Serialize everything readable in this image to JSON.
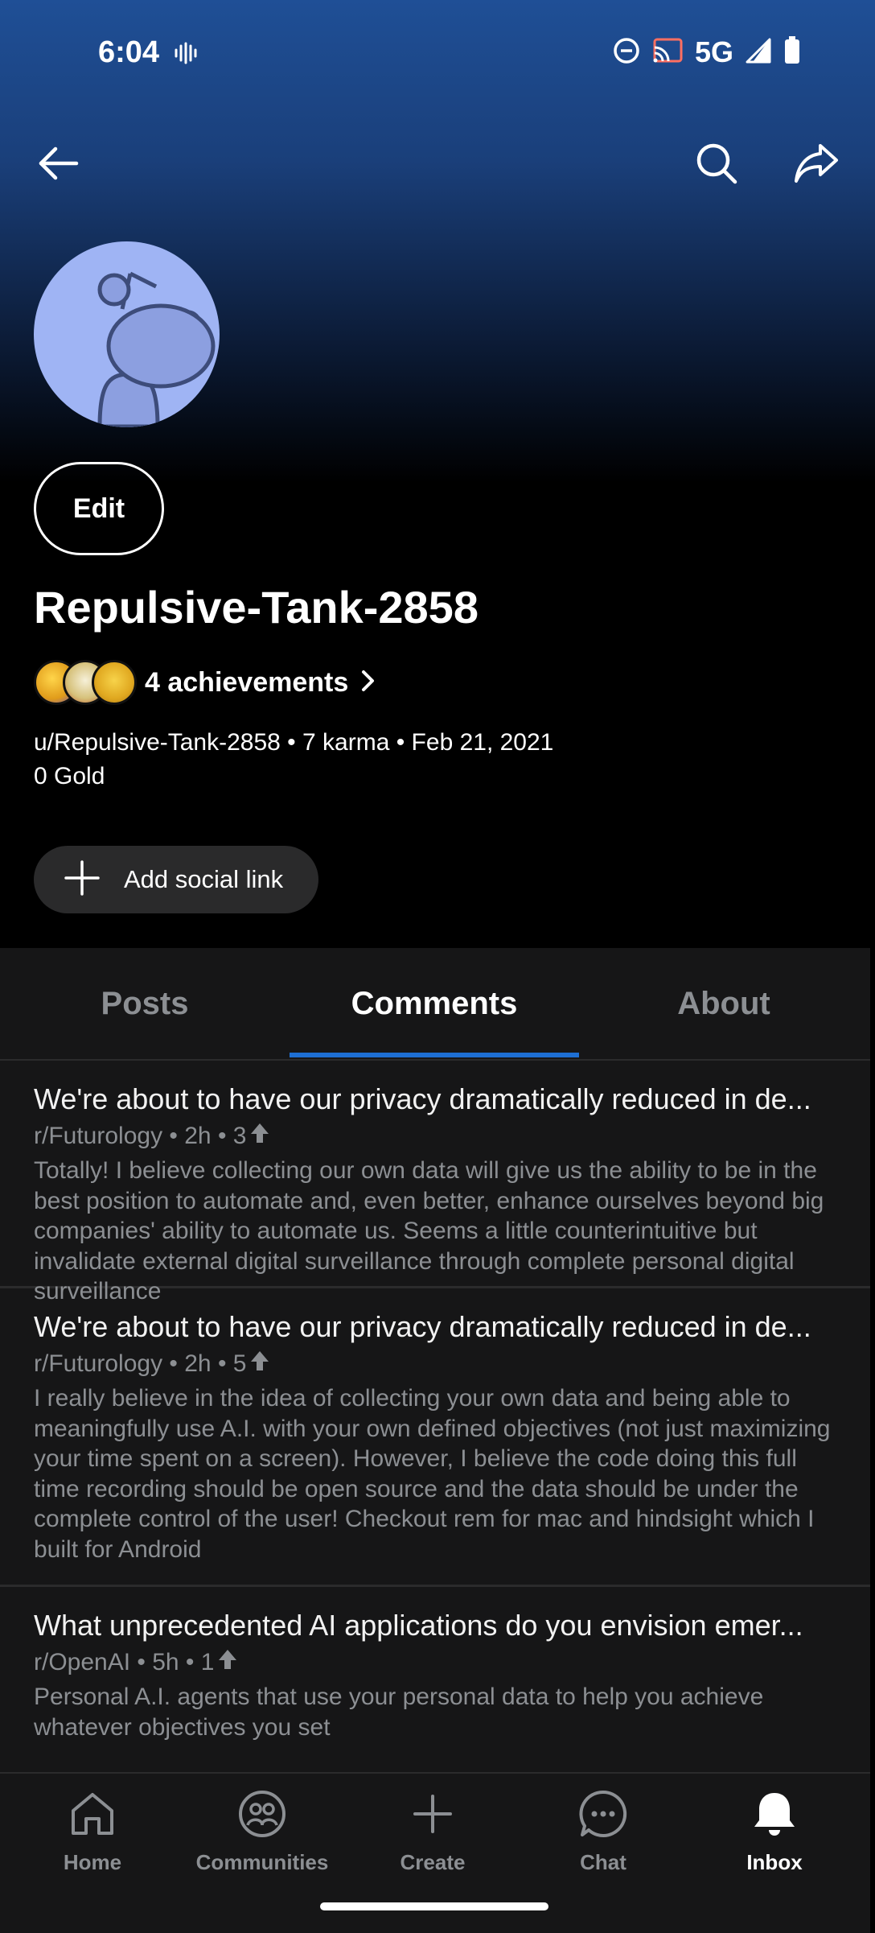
{
  "status_bar": {
    "time": "6:04",
    "network": "5G",
    "icons": [
      "vibrate-icon",
      "do-not-disturb-icon",
      "cast-icon",
      "signal-icon",
      "battery-icon"
    ]
  },
  "header": {
    "back_icon": "arrow-left-icon",
    "search_icon": "search-icon",
    "share_icon": "share-icon"
  },
  "profile": {
    "edit_label": "Edit",
    "display_name": "Repulsive-Tank-2858",
    "achievements_label": "4 achievements",
    "meta_line": "u/Repulsive-Tank-2858 • 7 karma • Feb 21, 2021",
    "gold_line": "0 Gold",
    "social_link_label": "Add social link"
  },
  "tabs": [
    {
      "label": "Posts",
      "active": false
    },
    {
      "label": "Comments",
      "active": true
    },
    {
      "label": "About",
      "active": false
    }
  ],
  "comments": [
    {
      "title": "We're about to have our privacy dramatically reduced in de...",
      "meta": "r/Futurology • 2h • 3",
      "body": "Totally! I believe collecting our own data will give us the ability to be in the best position to automate and, even better, enhance ourselves beyond big companies' ability to automate us. Seems a little counterintuitive but invalidate external digital surveillance through complete personal digital surveillance"
    },
    {
      "title": "We're about to have our privacy dramatically reduced in de...",
      "meta": "r/Futurology • 2h • 5",
      "body": "I really believe in the idea of collecting your own data and being able to meaningfully use A.I. with your own defined objectives (not just maximizing your time spent on a screen). However, I believe the code doing this full time recording should be open source and the data should be under the complete control of the user!  Checkout rem for mac and hindsight which I built for Android"
    },
    {
      "title": "What unprecedented AI applications do you envision emer...",
      "meta": "r/OpenAI • 5h • 1",
      "body": "Personal A.I. agents that use your personal data to help you achieve whatever objectives you set"
    }
  ],
  "bottom_nav": [
    {
      "label": "Home",
      "icon": "home-icon",
      "active": false
    },
    {
      "label": "Communities",
      "icon": "communities-icon",
      "active": false
    },
    {
      "label": "Create",
      "icon": "plus-icon",
      "active": false
    },
    {
      "label": "Chat",
      "icon": "chat-icon",
      "active": false
    },
    {
      "label": "Inbox",
      "icon": "bell-icon",
      "active": true
    }
  ],
  "colors": {
    "accent": "#1e6fd3",
    "avatar_bg": "#9fb4f4",
    "surface": "#161617",
    "muted_text": "#8c8f93"
  }
}
